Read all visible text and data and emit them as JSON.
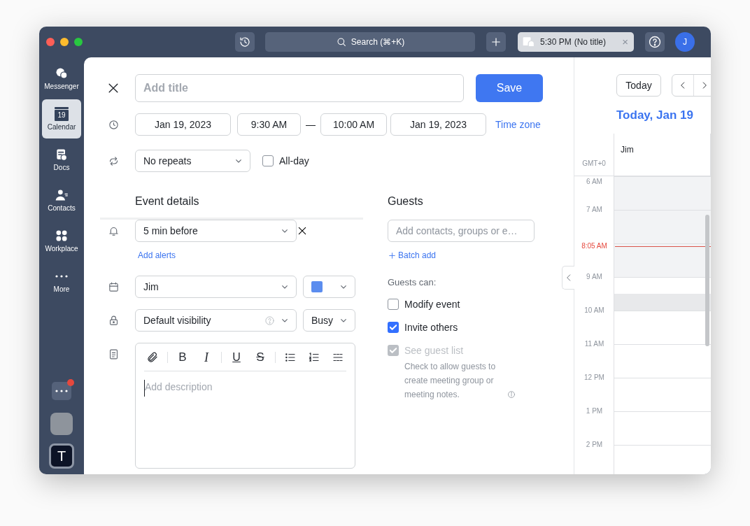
{
  "top_bar": {
    "search": {
      "placeholder": "Search (⌘+K)"
    },
    "reminder": {
      "time": "5:30 PM",
      "title": "(No title)",
      "close": "×"
    },
    "avatar": "J"
  },
  "sidebar": {
    "items": [
      {
        "label": "Messenger",
        "selected": false
      },
      {
        "label": "Calendar",
        "selected": true,
        "icon_text": "19"
      },
      {
        "label": "Docs",
        "selected": false
      },
      {
        "label": "Contacts",
        "selected": false
      },
      {
        "label": "Workplace",
        "selected": false
      },
      {
        "label": "More",
        "selected": false
      }
    ],
    "bottom": [
      {
        "kind": "more",
        "badge": true
      },
      {
        "kind": "blank"
      },
      {
        "kind": "app",
        "label": "T"
      }
    ]
  },
  "form": {
    "title": {
      "placeholder": "Add title"
    },
    "save": "Save",
    "start_date": "Jan 19, 2023",
    "start_time": "9:30 AM",
    "separator": "—",
    "end_time": "10:00 AM",
    "end_date": "Jan 19, 2023",
    "time_zone": "Time zone",
    "repeat": "No repeats",
    "all_day": {
      "label": "All-day",
      "checked": false
    },
    "event_details": "Event details",
    "alert": "5 min before",
    "add_alerts": "Add alerts",
    "calendar": "Jim",
    "visibility": "Default visibility",
    "availability": "Busy",
    "editor_toolbar": [
      [
        {
          "kind": "attach"
        }
      ],
      [
        {
          "kind": "bold",
          "label": "B"
        },
        {
          "kind": "italic",
          "label": "I"
        }
      ],
      [
        {
          "kind": "underline",
          "label": "U"
        },
        {
          "kind": "strike",
          "label": "S"
        }
      ],
      [
        {
          "kind": "bullets"
        },
        {
          "kind": "numbers"
        },
        {
          "kind": "rule"
        }
      ]
    ],
    "description": {
      "placeholder": "Add description"
    }
  },
  "guests": {
    "heading": "Guests",
    "input": {
      "placeholder": "Add contacts, groups or e…"
    },
    "batch_add": "Batch add",
    "can_label": "Guests can:",
    "permissions": [
      {
        "label": "Modify event",
        "checked": false,
        "disabled": false
      },
      {
        "label": "Invite others",
        "checked": true,
        "disabled": false
      },
      {
        "label": "See guest list",
        "checked": true,
        "disabled": true,
        "note": "Check to allow guests to create meeting group or meeting notes."
      }
    ]
  },
  "calendar_view": {
    "today": "Today",
    "date_heading": "Today, Jan 19",
    "column": "Jim",
    "timezone": "GMT+0",
    "new_event_slot_selected": true,
    "rows": [
      {
        "label": "6 AM",
        "past": true
      },
      {
        "label": "7 AM",
        "past": true
      },
      {
        "now": "8:05 AM",
        "past": true
      },
      {
        "label": "9 AM",
        "past": false
      },
      {
        "label": "10 AM",
        "past": false
      },
      {
        "label": "11 AM",
        "past": false
      },
      {
        "label": "12 PM",
        "past": false
      },
      {
        "label": "1 PM",
        "past": false
      },
      {
        "label": "2 PM",
        "past": false
      }
    ]
  }
}
